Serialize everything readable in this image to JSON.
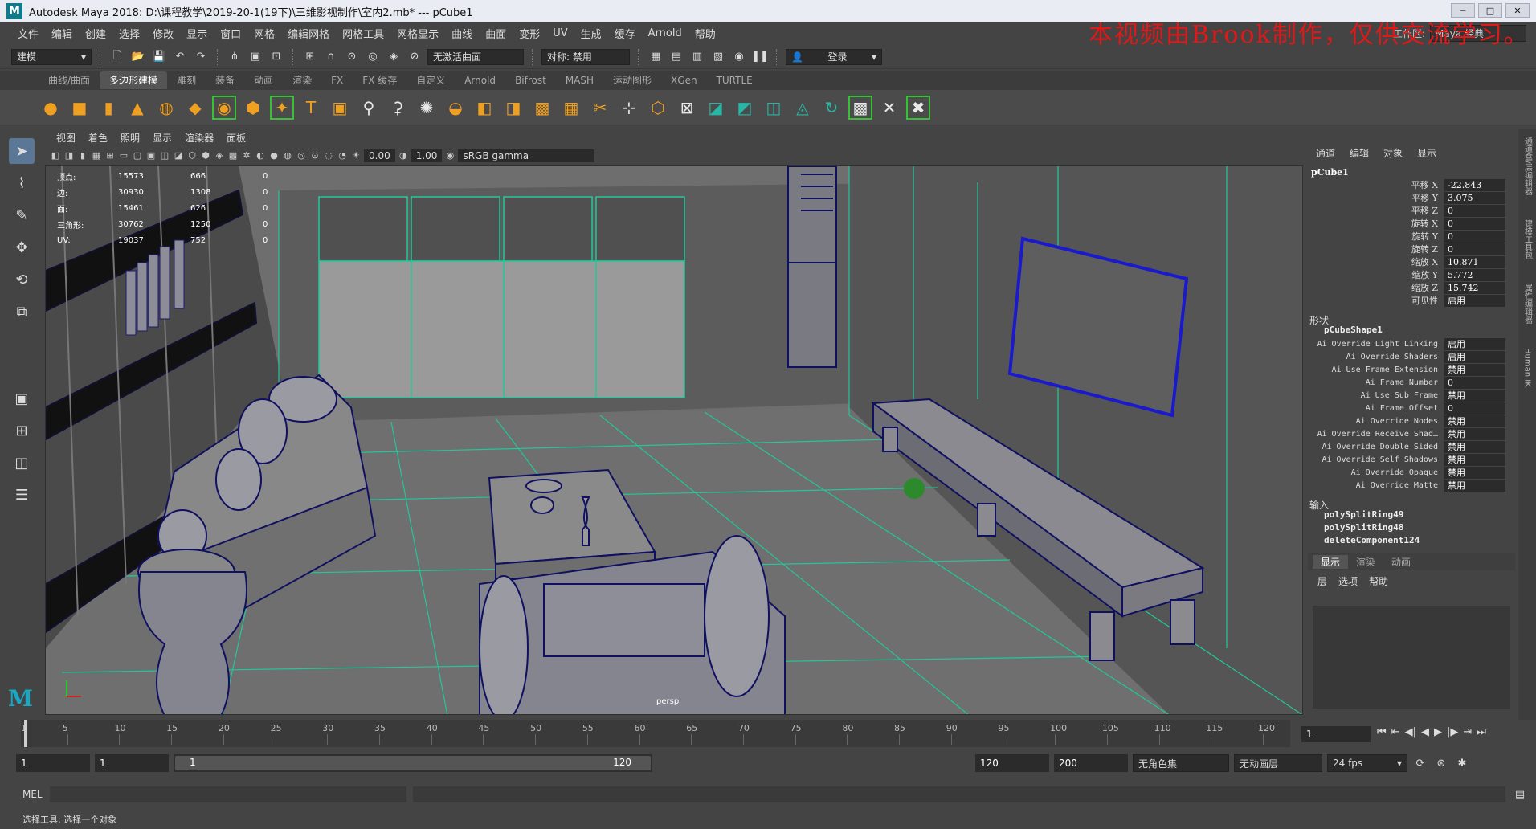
{
  "window": {
    "title": "Autodesk Maya 2018: D:\\课程教学\\2019-20-1(19下)\\三维影视制作\\室内2.mb*  ---  pCube1",
    "buttons": [
      "─",
      "□",
      "✕"
    ]
  },
  "watermark": "本视频由Brook制作，仅供交流学习。",
  "menubar": {
    "items": [
      "文件",
      "编辑",
      "创建",
      "选择",
      "修改",
      "显示",
      "窗口",
      "网格",
      "编辑网格",
      "网格工具",
      "网格显示",
      "曲线",
      "曲面",
      "变形",
      "UV",
      "生成",
      "缓存",
      "Arnold",
      "帮助"
    ],
    "workspace_label": "工作区:",
    "workspace_value": "Maya 经典"
  },
  "statusline": {
    "mode": "建模",
    "curve_mode": "无激活曲面",
    "symmetry": "对称: 禁用",
    "login": "登录"
  },
  "shelf": {
    "tabs": [
      "曲线/曲面",
      "多边形建模",
      "雕刻",
      "装备",
      "动画",
      "渲染",
      "FX",
      "FX 缓存",
      "自定义",
      "Arnold",
      "Bifrost",
      "MASH",
      "运动图形",
      "XGen",
      "TURTLE"
    ],
    "active_tab": "多边形建模",
    "icons": [
      "sphere-icon",
      "cube-icon",
      "cylinder-icon",
      "cone-icon",
      "torus-icon",
      "plane-icon",
      "disc-icon",
      "platonic-icon",
      "sparkle-icon",
      "text-icon",
      "svg-icon",
      "combine-icon",
      "separate-icon",
      "smooth-icon",
      "extrude-icon",
      "bridge-icon",
      "bevel-icon",
      "fill-icon",
      "merge-icon",
      "multicut-icon",
      "target-weld-icon",
      "quad-draw-icon",
      "uv-icon"
    ]
  },
  "toolbox": {
    "tools": [
      "select-arrow-icon",
      "lasso-icon",
      "paint-icon",
      "move-icon",
      "rotate-icon",
      "scale-icon",
      "layout-single-icon",
      "layout-four-icon",
      "layout-two-icon",
      "outliner-icon"
    ]
  },
  "viewport": {
    "menus": [
      "视图",
      "着色",
      "照明",
      "显示",
      "渲染器",
      "面板"
    ],
    "exposure": "0.00",
    "gamma": "1.00",
    "colorspace": "sRGB gamma",
    "camera_label": "persp",
    "hud": [
      {
        "label": "顶点:",
        "v1": "15573",
        "v2": "666",
        "v3": "0"
      },
      {
        "label": "边:",
        "v1": "30930",
        "v2": "1308",
        "v3": "0"
      },
      {
        "label": "面:",
        "v1": "15461",
        "v2": "626",
        "v3": "0"
      },
      {
        "label": "三角形:",
        "v1": "30762",
        "v2": "1250",
        "v3": "0"
      },
      {
        "label": "UV:",
        "v1": "19037",
        "v2": "752",
        "v3": "0"
      }
    ]
  },
  "channelbox": {
    "menus": [
      "通道",
      "编辑",
      "对象",
      "显示"
    ],
    "object": "pCube1",
    "transform": [
      {
        "name": "平移 X",
        "value": "-22.843"
      },
      {
        "name": "平移 Y",
        "value": "3.075"
      },
      {
        "name": "平移 Z",
        "value": "0"
      },
      {
        "name": "旋转 X",
        "value": "0"
      },
      {
        "name": "旋转 Y",
        "value": "0"
      },
      {
        "name": "旋转 Z",
        "value": "0"
      },
      {
        "name": "缩放 X",
        "value": "10.871"
      },
      {
        "name": "缩放 Y",
        "value": "5.772"
      },
      {
        "name": "缩放 Z",
        "value": "15.742"
      },
      {
        "name": "可见性",
        "value": "启用"
      }
    ],
    "shape_header": "形状",
    "shape_name": "pCubeShape1",
    "shape_attrs": [
      {
        "name": "Ai Override Light Linking",
        "value": "启用"
      },
      {
        "name": "Ai Override Shaders",
        "value": "启用"
      },
      {
        "name": "Ai Use Frame Extension",
        "value": "禁用"
      },
      {
        "name": "Ai Frame Number",
        "value": "0"
      },
      {
        "name": "Ai Use Sub Frame",
        "value": "禁用"
      },
      {
        "name": "Ai Frame Offset",
        "value": "0"
      },
      {
        "name": "Ai Override Nodes",
        "value": "禁用"
      },
      {
        "name": "Ai Override Receive Shad…",
        "value": "禁用"
      },
      {
        "name": "Ai Override Double Sided",
        "value": "禁用"
      },
      {
        "name": "Ai Override Self Shadows",
        "value": "禁用"
      },
      {
        "name": "Ai Override Opaque",
        "value": "禁用"
      },
      {
        "name": "Ai Override Matte",
        "value": "禁用"
      }
    ],
    "inputs_header": "输入",
    "inputs": [
      "polySplitRing49",
      "polySplitRing48",
      "deleteComponent124"
    ],
    "layer_tabs": [
      "显示",
      "渲染",
      "动画"
    ],
    "layer_menu": [
      "层",
      "选项",
      "帮助"
    ]
  },
  "side_tabs": [
    "通道盒/层编辑器",
    "建模工具包",
    "属性编辑器",
    "Human IK"
  ],
  "timeslider": {
    "ticks": [
      "1",
      "5",
      "10",
      "15",
      "20",
      "25",
      "30",
      "35",
      "40",
      "45",
      "50",
      "55",
      "60",
      "65",
      "70",
      "75",
      "80",
      "85",
      "90",
      "95",
      "100",
      "105",
      "110",
      "115",
      "120"
    ],
    "current_frame": "1"
  },
  "rangeslider": {
    "start": "1",
    "playback_start": "1",
    "range_start": "1",
    "range_end": "120",
    "playback_end": "120",
    "end": "200",
    "character_set": "无角色集",
    "anim_layer": "无动画层",
    "fps": "24 fps"
  },
  "commandline": {
    "label": "MEL"
  },
  "helpline": "选择工具: 选择一个对象"
}
